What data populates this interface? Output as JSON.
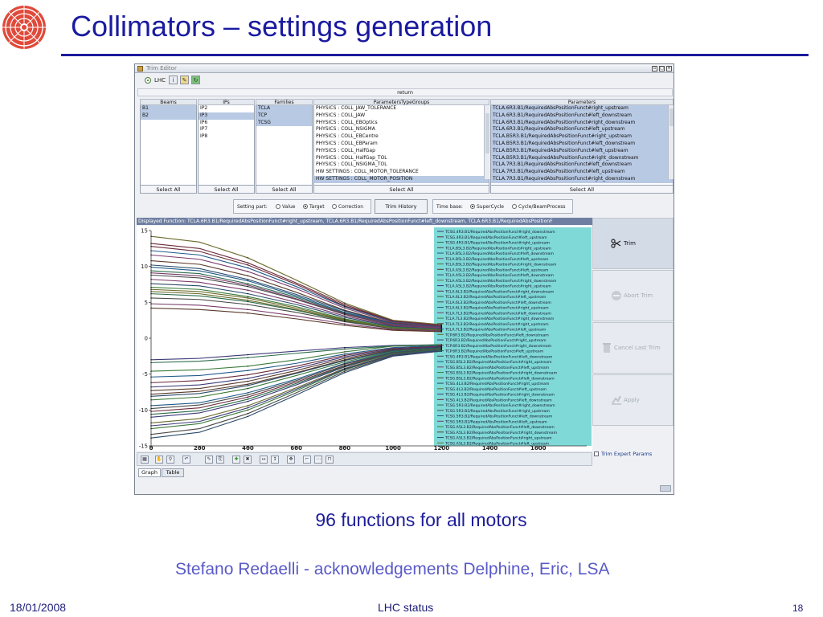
{
  "slide": {
    "title": "Collimators – settings generation",
    "caption": "96 functions for all motors",
    "credits": "Stefano Redaelli  - acknowledgements Delphine, Eric, LSA",
    "footer_date": "18/01/2008",
    "footer_center": "LHC status",
    "footer_page": "18"
  },
  "window": {
    "title": "Trim Editor",
    "lhc_label": "LHC",
    "return_label": "return",
    "icons": [
      "info-icon",
      "settings-icon",
      "refresh-icon"
    ]
  },
  "selectors": {
    "beams": {
      "header": "Beams",
      "items": [
        "B1",
        "B2"
      ],
      "select_all": "Select All"
    },
    "ips": {
      "header": "IPs",
      "items": [
        "IP2",
        "IP3",
        "IP6",
        "IP7",
        "IP8"
      ],
      "select_all": "Select All"
    },
    "families": {
      "header": "Families",
      "items": [
        "TCLA",
        "TCP",
        "TCSG"
      ],
      "select_all": "Select All"
    },
    "parameter_type_groups": {
      "header": "ParametersTypeGroups",
      "items": [
        "PHYSICS : COLL_JAW_TOLERANCE",
        "PHYSICS : COLL_JAW",
        "PHYSICS : COLL_EBOptics",
        "PHYSICS : COLL_NSIGMA",
        "PHYSICS : COLL_EBCentre",
        "PHYSICS : COLL_EBParam",
        "PHYSICS : COLL_HalfGap",
        "PHYSICS : COLL_HalfGap_TOL",
        "PHYSICS : COLL_NSIGMA_TOL",
        "HW SETTINGS : COLL_MOTOR_TOLERANCE",
        "HW SETTINGS : COLL_MOTOR_POSITION"
      ],
      "select_all": "Select All"
    },
    "parameters": {
      "header": "Parameters",
      "items": [
        "TCLA.6R3.B1/RequiredAbsPositionFunct#right_upstream",
        "TCLA.6R3.B1/RequiredAbsPositionFunct#left_downstream",
        "TCLA.6R3.B1/RequiredAbsPositionFunct#right_downstream",
        "TCLA.6R3.B1/RequiredAbsPositionFunct#left_upstream",
        "TCLA.B5R3.B1/RequiredAbsPositionFunct#right_upstream",
        "TCLA.B5R3.B1/RequiredAbsPositionFunct#left_downstream",
        "TCLA.B5R3.B1/RequiredAbsPositionFunct#left_upstream",
        "TCLA.B5R3.B1/RequiredAbsPositionFunct#right_downstream",
        "TCLA.7R3.B1/RequiredAbsPositionFunct#left_downstream",
        "TCLA.7R3.B1/RequiredAbsPositionFunct#left_upstream",
        "TCLA.7R3.B1/RequiredAbsPositionFunct#right_downstream"
      ],
      "select_all": "Select All"
    }
  },
  "controls": {
    "setting_part_label": "Setting part:",
    "setting_part_options": [
      "Value",
      "Target",
      "Correction"
    ],
    "setting_part_selected": "Target",
    "trim_history": "Trim History",
    "time_base_label": "Time base:",
    "time_base_options": [
      "SuperCycle",
      "Cycle/BeamProcess"
    ],
    "time_base_selected": "SuperCycle"
  },
  "displayed_function": "Displayed Function: TCLA.6R3.B1/RequiredAbsPositionFunct#right_upstream, TCLA.6R3.B1/RequiredAbsPositionFunct#left_downstream, TCLA.6R3.B1/RequiredAbsPositionF",
  "actions": {
    "trim": "Trim",
    "abort_trim": "Abort Trim",
    "cancel_last_trim": "Cancel Last Trim",
    "apply": "Apply",
    "trim_expert_params": "Trim Expert Params"
  },
  "tabs": [
    "Graph",
    "Table"
  ],
  "tabs_active": "Graph",
  "chart_data": {
    "type": "line",
    "title": "",
    "xlabel": "",
    "ylabel": "",
    "xlim": [
      0,
      1800
    ],
    "ylim": [
      -15,
      15
    ],
    "x_ticks": [
      0,
      200,
      400,
      600,
      800,
      1000,
      1200,
      1400,
      1600
    ],
    "y_ticks": [
      15,
      10,
      5,
      0,
      -5,
      -10,
      -15
    ],
    "x": [
      0,
      200,
      400,
      600,
      800,
      1000,
      1200
    ],
    "series": [
      {
        "name": "TCSG.4R3.B1/RequiredAbsPositionFunct#right_downstream",
        "values": [
          -3.0,
          -2.8,
          -2.3,
          -1.8,
          -1.3,
          -1.0,
          -0.9
        ]
      },
      {
        "name": "TCSG.4R3.B1/RequiredAbsPositionFunct#left_upstream",
        "values": [
          13.2,
          12.5,
          10.5,
          7.7,
          4.7,
          2.4,
          1.8
        ]
      },
      {
        "name": "TCSG.4R3.B1/RequiredAbsPositionFunct#right_upstream",
        "values": [
          -3.4,
          -3.2,
          -2.7,
          -2.1,
          -1.5,
          -1.1,
          -0.9
        ]
      },
      {
        "name": "TCLA.B5L3.B2/RequiredAbsPositionFunct#right_upstream",
        "values": [
          -13.4,
          -12.6,
          -10.5,
          -7.6,
          -4.6,
          -2.4,
          -1.8
        ]
      },
      {
        "name": "TCLA.B5L3.B2/RequiredAbsPositionFunct#left_downstream",
        "values": [
          12.2,
          11.6,
          9.8,
          7.2,
          4.4,
          2.3,
          1.7
        ]
      },
      {
        "name": "TCLA.B5L3.B2/RequiredAbsPositionFunct#left_upstream",
        "values": [
          11.6,
          11.0,
          9.3,
          6.9,
          4.2,
          2.2,
          1.7
        ]
      },
      {
        "name": "TCLA.B5L3.B2/RequiredAbsPositionFunct#right_downstream",
        "values": [
          -12.6,
          -11.9,
          -10.0,
          -7.3,
          -4.4,
          -2.3,
          -1.7
        ]
      },
      {
        "name": "TCLA.A5L3.B2/RequiredAbsPositionFunct#left_upstream",
        "values": [
          10.8,
          10.3,
          8.7,
          6.4,
          3.9,
          2.1,
          1.6
        ]
      },
      {
        "name": "TCLA.A5L3.B2/RequiredAbsPositionFunct#left_downstream",
        "values": [
          10.2,
          9.7,
          8.2,
          6.1,
          3.8,
          2.0,
          1.6
        ]
      },
      {
        "name": "TCLA.A5L3.B2/RequiredAbsPositionFunct#right_downstream",
        "values": [
          -11.8,
          -11.2,
          -9.4,
          -6.9,
          -4.2,
          -2.2,
          -1.7
        ]
      },
      {
        "name": "TCLA.A5L3.B2/RequiredAbsPositionFunct#right_upstream",
        "values": [
          -11.0,
          -10.4,
          -8.8,
          -6.5,
          -4.0,
          -2.1,
          -1.6
        ]
      },
      {
        "name": "TCLA.6L3.B2/RequiredAbsPositionFunct#right_downstream",
        "values": [
          -10.2,
          -9.7,
          -8.2,
          -6.1,
          -3.8,
          -2.0,
          -1.6
        ]
      },
      {
        "name": "TCLA.6L3.B2/RequiredAbsPositionFunct#left_upstream",
        "values": [
          9.4,
          9.0,
          7.6,
          5.7,
          3.5,
          1.9,
          1.5
        ]
      },
      {
        "name": "TCLA.6L3.B2/RequiredAbsPositionFunct#left_downstream",
        "values": [
          8.8,
          8.4,
          7.2,
          5.4,
          3.3,
          1.8,
          1.4
        ]
      },
      {
        "name": "TCLA.6L3.B2/RequiredAbsPositionFunct#right_upstream",
        "values": [
          -9.4,
          -9.0,
          -7.6,
          -5.7,
          -3.5,
          -1.9,
          -1.5
        ]
      },
      {
        "name": "TCLA.7L3.B2/RequiredAbsPositionFunct#left_downstream",
        "values": [
          8.2,
          7.8,
          6.7,
          5.0,
          3.1,
          1.7,
          1.4
        ]
      },
      {
        "name": "TCLA.7L3.B2/RequiredAbsPositionFunct#right_downstream",
        "values": [
          -8.6,
          -8.2,
          -7.0,
          -5.2,
          -3.3,
          -1.8,
          -1.4
        ]
      },
      {
        "name": "TCLA.7L3.B2/RequiredAbsPositionFunct#right_upstream",
        "values": [
          -7.8,
          -7.4,
          -6.4,
          -4.8,
          -3.0,
          -1.7,
          -1.3
        ]
      },
      {
        "name": "TCLA.7L3.B2/RequiredAbsPositionFunct#left_upstream",
        "values": [
          7.6,
          7.3,
          6.2,
          4.7,
          2.9,
          1.6,
          1.3
        ]
      },
      {
        "name": "TCP.6R3.B2/RequiredAbsPositionFunct#left_downstream",
        "values": [
          6.8,
          6.5,
          5.6,
          4.2,
          2.6,
          1.5,
          1.2
        ]
      },
      {
        "name": "TCP.6R3.B2/RequiredAbsPositionFunct#right_upstream",
        "values": [
          -6.8,
          -6.5,
          -5.6,
          -4.2,
          -2.6,
          -1.5,
          -1.2
        ]
      },
      {
        "name": "TCP.6R3.B2/RequiredAbsPositionFunct#right_downstream",
        "values": [
          -6.2,
          -5.9,
          -5.1,
          -3.9,
          -2.4,
          -1.4,
          -1.1
        ]
      },
      {
        "name": "TCP.6R3.B2/RequiredAbsPositionFunct#left_upstream",
        "values": [
          6.2,
          5.9,
          5.1,
          3.9,
          2.4,
          1.4,
          1.1
        ]
      },
      {
        "name": "TCSG.4R3.B1/RequiredAbsPositionFunct#left_downstream",
        "values": [
          5.6,
          5.4,
          4.7,
          3.6,
          2.3,
          1.3,
          1.1
        ]
      },
      {
        "name": "TCSG.B5L3.B2/RequiredAbsPositionFunct#right_upstream",
        "values": [
          -5.4,
          -5.2,
          -4.5,
          -3.5,
          -2.2,
          -1.3,
          -1.0
        ]
      },
      {
        "name": "TCSG.B5L3.B2/RequiredAbsPositionFunct#left_upstream",
        "values": [
          4.8,
          4.6,
          4.0,
          3.1,
          2.0,
          1.2,
          1.0
        ]
      },
      {
        "name": "TCSG.B5L3.B2/RequiredAbsPositionFunct#right_downstream",
        "values": [
          -4.6,
          -4.4,
          -3.9,
          -3.0,
          -1.9,
          -1.1,
          -0.9
        ]
      },
      {
        "name": "TCSG.B5L3.B2/RequiredAbsPositionFunct#left_downstream",
        "values": [
          4.2,
          4.0,
          3.5,
          2.7,
          1.8,
          1.1,
          0.9
        ]
      },
      {
        "name": "TCSG.4L3.B2/RequiredAbsPositionFunct#right_upstream",
        "values": [
          -13.9,
          -13.1,
          -10.9,
          -7.9,
          -4.8,
          -2.5,
          -1.8
        ]
      },
      {
        "name": "TCSG.4L3.B2/RequiredAbsPositionFunct#left_upstream",
        "values": [
          14.2,
          13.4,
          11.2,
          8.1,
          4.9,
          2.5,
          1.9
        ]
      },
      {
        "name": "TCSG.4L3.B2/RequiredAbsPositionFunct#right_downstream",
        "values": [
          -12.2,
          -11.6,
          -9.7,
          -7.1,
          -4.3,
          -2.3,
          -1.7
        ]
      },
      {
        "name": "TCSG.4L3.B2/RequiredAbsPositionFunct#left_downstream",
        "values": [
          12.8,
          12.1,
          10.2,
          7.5,
          4.5,
          2.4,
          1.8
        ]
      },
      {
        "name": "TCSG.5R3.B2/RequiredAbsPositionFunct#right_downstream",
        "values": [
          -10.6,
          -10.1,
          -8.5,
          -6.3,
          -3.9,
          -2.1,
          -1.6
        ]
      },
      {
        "name": "TCSG.5R3.B2/RequiredAbsPositionFunct#right_upstream",
        "values": [
          -9.8,
          -9.3,
          -7.9,
          -5.9,
          -3.6,
          -2.0,
          -1.5
        ]
      },
      {
        "name": "TCSG.5R3.B2/RequiredAbsPositionFunct#left_downstream",
        "values": [
          9.9,
          9.4,
          8.0,
          5.9,
          3.6,
          2.0,
          1.5
        ]
      },
      {
        "name": "TCSG.5R3.B2/RequiredAbsPositionFunct#left_upstream",
        "values": [
          9.1,
          8.7,
          7.4,
          5.5,
          3.4,
          1.9,
          1.5
        ]
      },
      {
        "name": "TCSG.A5L3.B2/RequiredAbsPositionFunct#left_downstream",
        "values": [
          7.1,
          6.8,
          5.8,
          4.4,
          2.7,
          1.5,
          1.2
        ]
      },
      {
        "name": "TCSG.A5L3.B2/RequiredAbsPositionFunct#right_downstream",
        "values": [
          -7.3,
          -7.0,
          -6.0,
          -4.5,
          -2.8,
          -1.6,
          -1.3
        ]
      },
      {
        "name": "TCSG.A5L3.B2/RequiredAbsPositionFunct#right_upstream",
        "values": [
          -8.1,
          -7.7,
          -6.6,
          -4.9,
          -3.1,
          -1.7,
          -1.3
        ]
      },
      {
        "name": "TCSG.A5L3.B2/RequiredAbsPositionFunct#left_upstream",
        "values": [
          6.5,
          6.2,
          5.3,
          4.0,
          2.5,
          1.4,
          1.2
        ]
      }
    ],
    "legend_position": "right",
    "grid": false
  }
}
